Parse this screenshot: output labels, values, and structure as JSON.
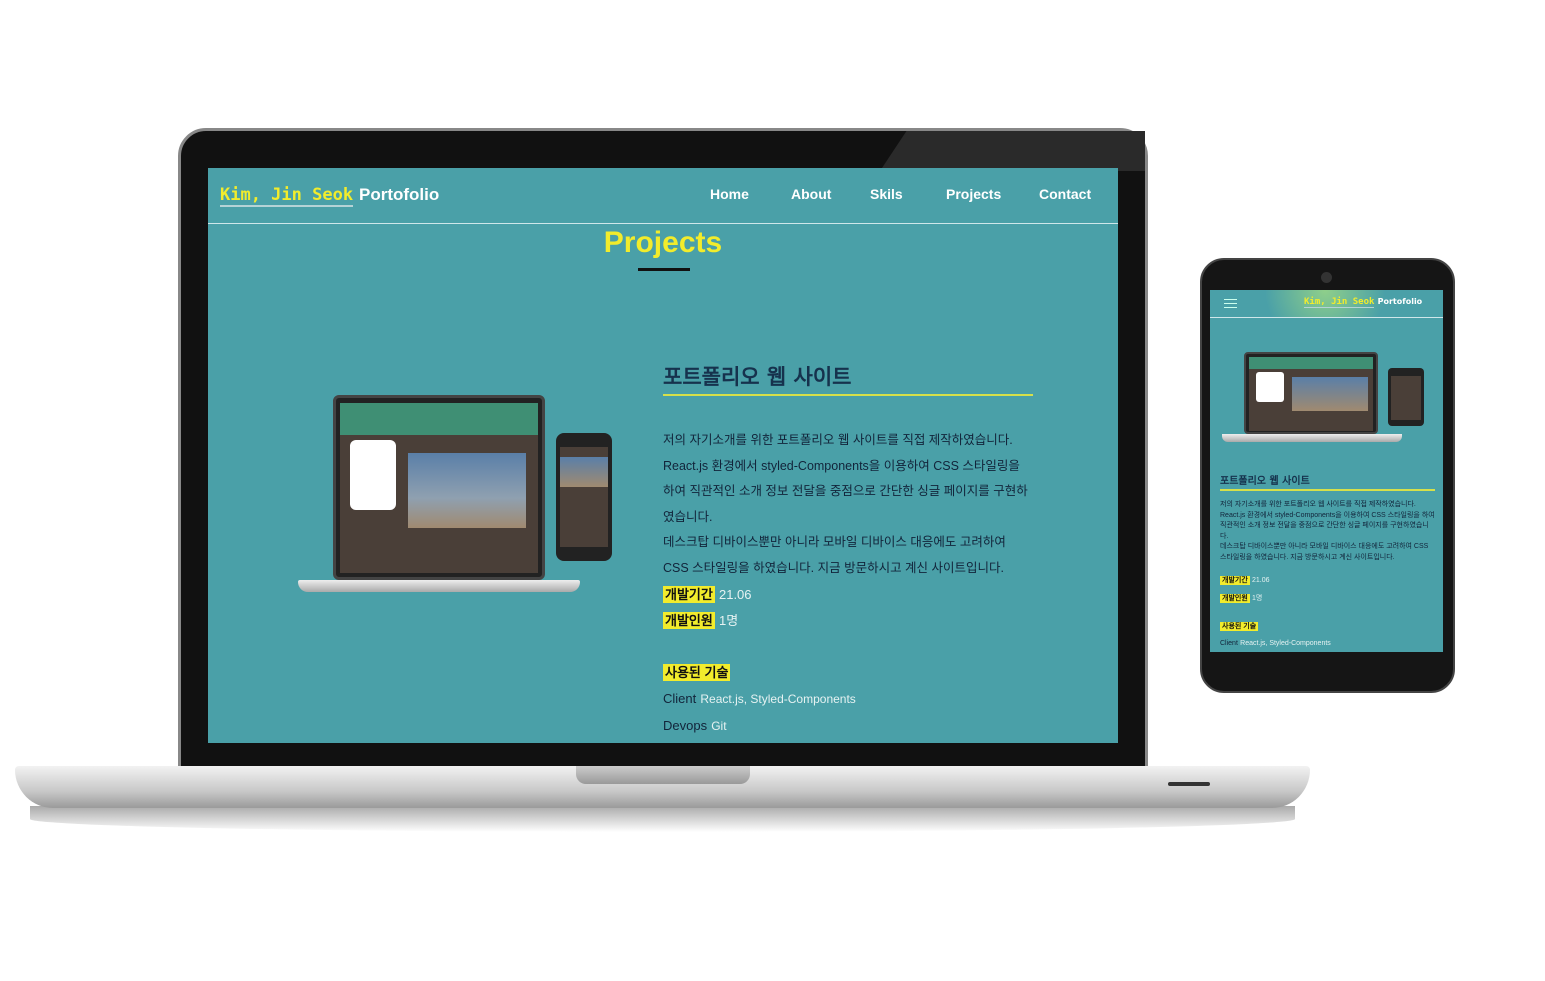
{
  "colors": {
    "background": "#4aa0a8",
    "accent": "#f2ec2c",
    "heading": "#16324d"
  },
  "site": {
    "brand_name": "Kim, Jin Seok",
    "brand_suffix": "Portofolio",
    "nav": [
      "Home",
      "About",
      "Skils",
      "Projects",
      "Contact"
    ],
    "menu_icon": "hamburger-icon",
    "section_title": "Projects"
  },
  "project": {
    "title": "포트폴리오 웹 사이트",
    "description_1": "저의 자기소개를 위한 포트폴리오 웹 사이트를 직접 제작하였습니다. React.js 환경에서 styled-Components을 이용하여 CSS 스타일링을 하여 직관적인 소개 정보 전달을 중점으로 간단한 싱글 페이지를 구현하였습니다.",
    "description_2": "데스크탑 디바이스뿐만 아니라 모바일 디바이스 대응에도 고려하여 CSS 스타일링을 하였습니다. 지금 방문하시고 계신 사이트입니다.",
    "period_label": "개발기간",
    "period": "21.06",
    "people_label": "개발인원",
    "people": "1명",
    "tech_label": "사용된 기술",
    "client_label": "Client",
    "client": "React.js, Styled-Components",
    "devops_label": "Devops",
    "devops": "Git"
  }
}
